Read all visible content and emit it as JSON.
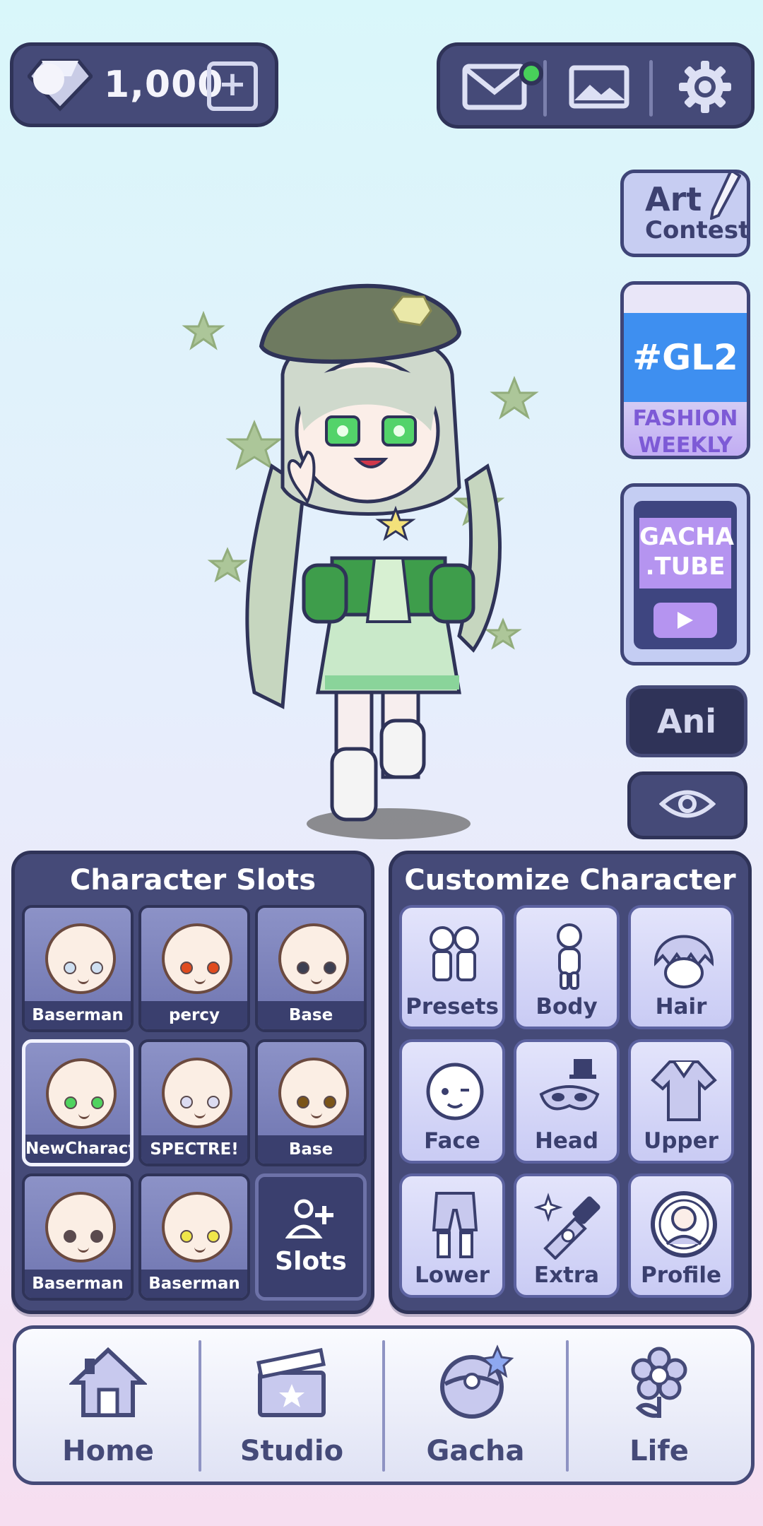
{
  "topbar": {
    "gem_count": "1,000",
    "gem_add_label": "+"
  },
  "side": {
    "art_contest": {
      "line1": "Art",
      "line2": "Contest"
    },
    "gl2": {
      "tag": "#GL2",
      "line1": "FASHION",
      "line2": "WEEKLY"
    },
    "gacha_tube": {
      "line1": "GACHA",
      "line2": ".TUBE"
    },
    "ani_label": "Ani"
  },
  "slots_panel": {
    "title": "Character Slots",
    "slots": [
      {
        "label": "Baserman",
        "eye_color": "#cfe0f2"
      },
      {
        "label": "percy",
        "eye_color": "#e04b1e"
      },
      {
        "label": "Base",
        "eye_color": "#3c3f52"
      },
      {
        "label": "NewCharacte",
        "eye_color": "#4fd35f",
        "selected": true
      },
      {
        "label": "SPECTRE!",
        "eye_color": "#dcdcf2"
      },
      {
        "label": "Base",
        "eye_color": "#7a5418"
      },
      {
        "label": "Baserman",
        "eye_color": "#5a4a4e"
      },
      {
        "label": "Baserman",
        "eye_color": "#f0e64a"
      }
    ],
    "add_slots_label": "Slots"
  },
  "customize_panel": {
    "title": "Customize Character",
    "buttons": [
      {
        "label": "Presets",
        "icon": "presets-icon"
      },
      {
        "label": "Body",
        "icon": "body-icon"
      },
      {
        "label": "Hair",
        "icon": "hair-icon"
      },
      {
        "label": "Face",
        "icon": "face-icon"
      },
      {
        "label": "Head",
        "icon": "head-icon"
      },
      {
        "label": "Upper",
        "icon": "upper-icon"
      },
      {
        "label": "Lower",
        "icon": "lower-icon"
      },
      {
        "label": "Extra",
        "icon": "extra-icon"
      },
      {
        "label": "Profile",
        "icon": "profile-icon"
      }
    ]
  },
  "bottom_nav": [
    {
      "label": "Home",
      "icon": "home-icon"
    },
    {
      "label": "Studio",
      "icon": "clapperboard-icon"
    },
    {
      "label": "Gacha",
      "icon": "gacha-icon"
    },
    {
      "label": "Life",
      "icon": "flower-icon"
    }
  ],
  "colors": {
    "panel": "#454a78",
    "panel_border": "#2f3358",
    "accent_green": "#48d05a",
    "tube_purple": "#b594f0"
  }
}
